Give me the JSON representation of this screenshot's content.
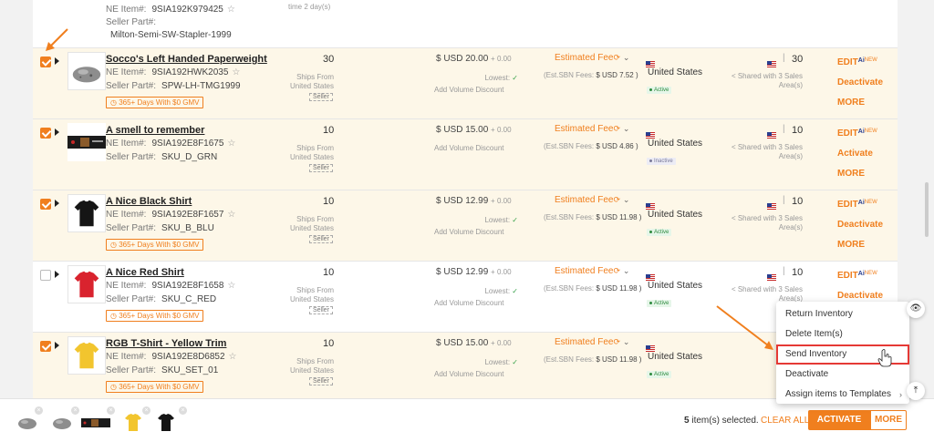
{
  "top": {
    "ne_label": "NE Item#:",
    "ne_value": "9SIA192K979425",
    "seller_label": "Seller Part#:",
    "seller_value": "Milton-Semi-SW-Stapler-1999",
    "time_note": "time 2 day(s)"
  },
  "common": {
    "ne_label": "NE Item#:",
    "seller_label": "Seller Part#:",
    "gmv": "365+ Days With $0 GMV",
    "ships_from": "Ships From United States",
    "seller_tag": "Seller",
    "lowest": "Lowest:",
    "volume": "Add Volume Discount",
    "fee": "Estimated Fee",
    "sbn_label": "(Est.SBN Fees:",
    "country": "United States",
    "edit": "EDIT",
    "ai": "Ai",
    "new": "NEW",
    "more": "MORE",
    "star": "☆"
  },
  "rows": [
    {
      "title": "Socco's Left Handed Paperweight",
      "ne": "9SIA192HWK2035",
      "seller": "SPW-LH-TMG1999",
      "qty": "30",
      "price": "$ USD 20.00",
      "plus": "+ 0.00",
      "fee_amt": "$ USD 7.52 )",
      "status": "Active",
      "shared_qty": "30",
      "shared": "Shared with 3 Sales Area(s)",
      "action2": "Deactivate",
      "checked": true
    },
    {
      "title": "A smell to remember",
      "ne": "9SIA192E8F1675",
      "seller": "SKU_D_GRN",
      "qty": "10",
      "price": "$ USD 15.00",
      "plus": "+ 0.00",
      "fee_amt": "$ USD 4.86 )",
      "status": "Inactive",
      "shared_qty": "10",
      "shared": "Shared with 3 Sales Area(s)",
      "action2": "Activate",
      "checked": true
    },
    {
      "title": "A Nice Black Shirt",
      "ne": "9SIA192E8F1657",
      "seller": "SKU_B_BLU",
      "qty": "10",
      "price": "$ USD 12.99",
      "plus": "+ 0.00",
      "fee_amt": "$ USD 11.98 )",
      "status": "Active",
      "shared_qty": "10",
      "shared": "Shared with 3 Sales Area(s)",
      "action2": "Deactivate",
      "checked": true
    },
    {
      "title": "A Nice Red Shirt",
      "ne": "9SIA192E8F1658",
      "seller": "SKU_C_RED",
      "qty": "10",
      "price": "$ USD 12.99",
      "plus": "+ 0.00",
      "fee_amt": "$ USD 11.98 )",
      "status": "Active",
      "shared_qty": "10",
      "shared": "Shared with 3 Sales Area(s)",
      "action2": "Deactivate",
      "checked": false
    },
    {
      "title": "RGB T-Shirt - Yellow Trim",
      "ne": "9SIA192E8D6852",
      "seller": "SKU_SET_01",
      "qty": "10",
      "price": "$ USD 15.00",
      "plus": "+ 0.00",
      "fee_amt": "$ USD 11.98 )",
      "status": "Active",
      "shared_qty": "",
      "shared": "",
      "action2": "",
      "checked": true
    }
  ],
  "menu": {
    "items": [
      "Return Inventory",
      "Delete Item(s)",
      "Send Inventory",
      "Deactivate",
      "Assign items to Templates"
    ],
    "highlighted": "Send Inventory"
  },
  "footer": {
    "count": "5",
    "count_suffix": "item(s) selected.",
    "clear": "CLEAR ALL",
    "activate": "ACTIVATE",
    "more": "MORE"
  },
  "colors": {
    "accent": "#f07f1e",
    "selected_row": "#fdf7e8",
    "active_green": "#2e8b3f",
    "highlight_box": "#e53935"
  }
}
